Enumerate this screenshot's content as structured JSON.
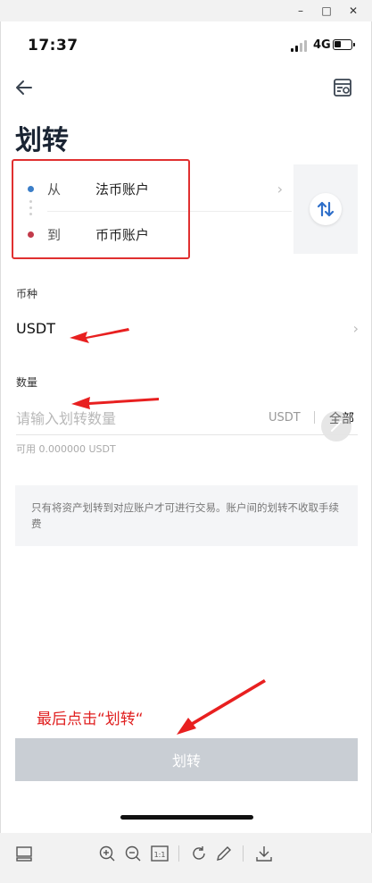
{
  "window": {
    "minimize_glyph": "–",
    "maximize_glyph": "□",
    "close_glyph": "✕"
  },
  "status_bar": {
    "time": "17:37",
    "network": "4G"
  },
  "header": {
    "back_icon": "back-arrow-icon",
    "records_icon": "transfer-records-icon"
  },
  "page": {
    "title": "划转"
  },
  "transfer": {
    "from_label": "从",
    "from_account": "法币账户",
    "to_label": "到",
    "to_account": "币币账户",
    "from_dot_color": "#3b7ec8",
    "to_dot_color": "#c23a4a",
    "swap_icon": "swap-vertical-icon"
  },
  "currency": {
    "label": "币种",
    "value": "USDT"
  },
  "amount": {
    "label": "数量",
    "placeholder": "请输入划转数量",
    "unit": "USDT",
    "all_label": "全部",
    "available": "可用 0.000000 USDT"
  },
  "notice": {
    "text": "只有将资产划转到对应账户才可进行交易。账户间的划转不收取手续费"
  },
  "annotation": {
    "text": "最后点击“划转“",
    "color": "#e02020"
  },
  "submit": {
    "label": "划转"
  },
  "viewer_toolbar": {
    "icons": [
      "thumbnail-icon",
      "zoom-in-icon",
      "zoom-out-icon",
      "actual-size-icon",
      "rotate-icon",
      "edit-icon",
      "download-icon"
    ],
    "actual_size_label": "1:1"
  }
}
